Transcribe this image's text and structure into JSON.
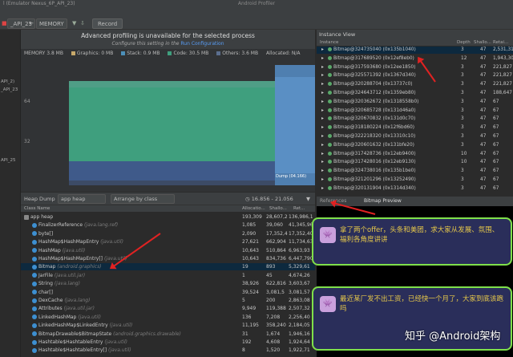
{
  "window": {
    "title": "Android Profiler",
    "left_title": "l (Emulator Nexus_6P_API_23)"
  },
  "toolbar": {
    "device": "_API_23",
    "process_prefix": "←",
    "memory_label": "MEMORY",
    "record_label": "Record"
  },
  "left_rail": [
    "API_2)",
    "_API_23",
    "API_25"
  ],
  "warning": {
    "title": "Advanced profiling is unavailable for the selected process",
    "subtitle_prefix": "Configure this setting in the",
    "subtitle_link": "Run Configuration"
  },
  "legend": {
    "memory": "MEMORY 3.8 MB",
    "graphics": "Graphics: 0 MB",
    "stack": "Stack: 0.9 MB",
    "code": "Code: 30.5 MB",
    "others": "Others: 3.6 MB",
    "allocated": "Allocated: N/A"
  },
  "chart_data": {
    "type": "area",
    "yticks": [
      "64",
      "32"
    ],
    "series_colors": {
      "code": "#3f9f7e",
      "others": "#5b6e8e",
      "stack": "#4c8fb8"
    },
    "dump_label": "Dump (04.166)"
  },
  "heap_bar": {
    "dump": "Heap Dump",
    "heap": "app heap",
    "arrange": "Arrange by class",
    "range": "16.856 - 21.056"
  },
  "class_table": {
    "headers": [
      "Class Name",
      "Allocatio...",
      "Shallo...",
      "Ret..."
    ],
    "rows": [
      {
        "name": "app heap",
        "pkg": "",
        "a": "193,309",
        "s": "28,607,2",
        "r": "136,986,1"
      },
      {
        "name": "FinalizerReference",
        "pkg": "(java.lang.ref)",
        "a": "1,085",
        "s": "39,060",
        "r": "41,345,96"
      },
      {
        "name": "byte[]",
        "pkg": "",
        "a": "2,090",
        "s": "17,352,4",
        "r": "17,352,40"
      },
      {
        "name": "HashMap$HashMapEntry",
        "pkg": "(java.util)",
        "a": "27,621",
        "s": "662,904",
        "r": "11,734,63"
      },
      {
        "name": "HashMap",
        "pkg": "(java.util)",
        "a": "10,643",
        "s": "510,864",
        "r": "6,963,93"
      },
      {
        "name": "HashMap$HashMapEntry[]",
        "pkg": "(java.util)",
        "a": "10,643",
        "s": "834,736",
        "r": "6,447,790"
      },
      {
        "name": "Bitmap",
        "pkg": "(android.graphics)",
        "a": "19",
        "s": "893",
        "r": "5,329,61"
      },
      {
        "name": "JarFile",
        "pkg": "(java.util.jar)",
        "a": "1",
        "s": "45",
        "r": "4,674,26"
      },
      {
        "name": "String",
        "pkg": "(java.lang)",
        "a": "38,926",
        "s": "622,816",
        "r": "3,603,67"
      },
      {
        "name": "char[]",
        "pkg": "",
        "a": "39,524",
        "s": "3,081,5",
        "r": "3,081,57"
      },
      {
        "name": "DexCache",
        "pkg": "(java.lang)",
        "a": "5",
        "s": "200",
        "r": "2,863,08"
      },
      {
        "name": "Attributes",
        "pkg": "(java.util.jar)",
        "a": "9,949",
        "s": "119,388",
        "r": "2,507,32"
      },
      {
        "name": "LinkedHashMap",
        "pkg": "(java.util)",
        "a": "136",
        "s": "7,208",
        "r": "2,256,40"
      },
      {
        "name": "LinkedHashMap$LinkedEntry",
        "pkg": "(java.util)",
        "a": "11,195",
        "s": "358,240",
        "r": "2,184,05"
      },
      {
        "name": "BitmapDrawable$BitmapState",
        "pkg": "(android.graphics.drawable)",
        "a": "31",
        "s": "1,674",
        "r": "1,946,16"
      },
      {
        "name": "Hashtable$HashtableEntry",
        "pkg": "(java.util)",
        "a": "192",
        "s": "4,608",
        "r": "1,924,64"
      },
      {
        "name": "Hashtable$HashtableEntry[]",
        "pkg": "(java.util)",
        "a": "8",
        "s": "1,520",
        "r": "1,922,71"
      }
    ]
  },
  "instance_view": {
    "title": "Instance View",
    "headers": [
      "Instance",
      "Depth",
      "Shallo...",
      "Retai..."
    ],
    "rows": [
      {
        "n": "Bitmap@324735040 (0x135b1040)",
        "d": "3",
        "s": "47",
        "r": "2,531,31"
      },
      {
        "n": "Bitmap@317689520 (0x12ef8eb0)",
        "d": "12",
        "s": "47",
        "r": "1,943,30"
      },
      {
        "n": "Bitmap@317593680 (0x12ee1850)",
        "d": "3",
        "s": "47",
        "r": "221,827"
      },
      {
        "n": "Bitmap@325571392 (0x1367d340)",
        "d": "3",
        "s": "47",
        "r": "221,827"
      },
      {
        "n": "Bitmap@320288704 (0x13737c0)",
        "d": "3",
        "s": "47",
        "r": "221,827"
      },
      {
        "n": "Bitmap@324643712 (0x1359eb80)",
        "d": "3",
        "s": "47",
        "r": "188,647"
      },
      {
        "n": "Bitmap@320362672 (0x1318558b0)",
        "d": "3",
        "s": "47",
        "r": "67"
      },
      {
        "n": "Bitmap@320685728 (0x131d46a0)",
        "d": "3",
        "s": "47",
        "r": "67"
      },
      {
        "n": "Bitmap@320670832 (0x131d0c70)",
        "d": "3",
        "s": "47",
        "r": "67"
      },
      {
        "n": "Bitmap@318180224 (0x12f6bd60)",
        "d": "3",
        "s": "47",
        "r": "67"
      },
      {
        "n": "Bitmap@322218320 (0x13310c10)",
        "d": "3",
        "s": "47",
        "r": "67"
      },
      {
        "n": "Bitmap@320601632 (0x131bfe20)",
        "d": "3",
        "s": "47",
        "r": "67"
      },
      {
        "n": "Bitmap@317428736 (0x12eb9400)",
        "d": "10",
        "s": "47",
        "r": "67"
      },
      {
        "n": "Bitmap@317428016 (0x12eb9130)",
        "d": "10",
        "s": "47",
        "r": "67"
      },
      {
        "n": "Bitmap@324738016 (0x135b1be0)",
        "d": "3",
        "s": "47",
        "r": "67"
      },
      {
        "n": "Bitmap@321201296 (0x13252490)",
        "d": "3",
        "s": "47",
        "r": "67"
      },
      {
        "n": "Bitmap@320131904 (0x1314d340)",
        "d": "3",
        "s": "47",
        "r": "67"
      }
    ]
  },
  "tabs": {
    "references": "References",
    "preview": "Bitmap Preview"
  },
  "preview": {
    "msg1": "拿了两个offer，头条和美团，求大家从发展、氛围、福利各角度讲讲",
    "msg2": "最近某厂发不出工资，已经快一个月了，大家到底该跑吗",
    "watermark": "知乎 @Android架构"
  }
}
